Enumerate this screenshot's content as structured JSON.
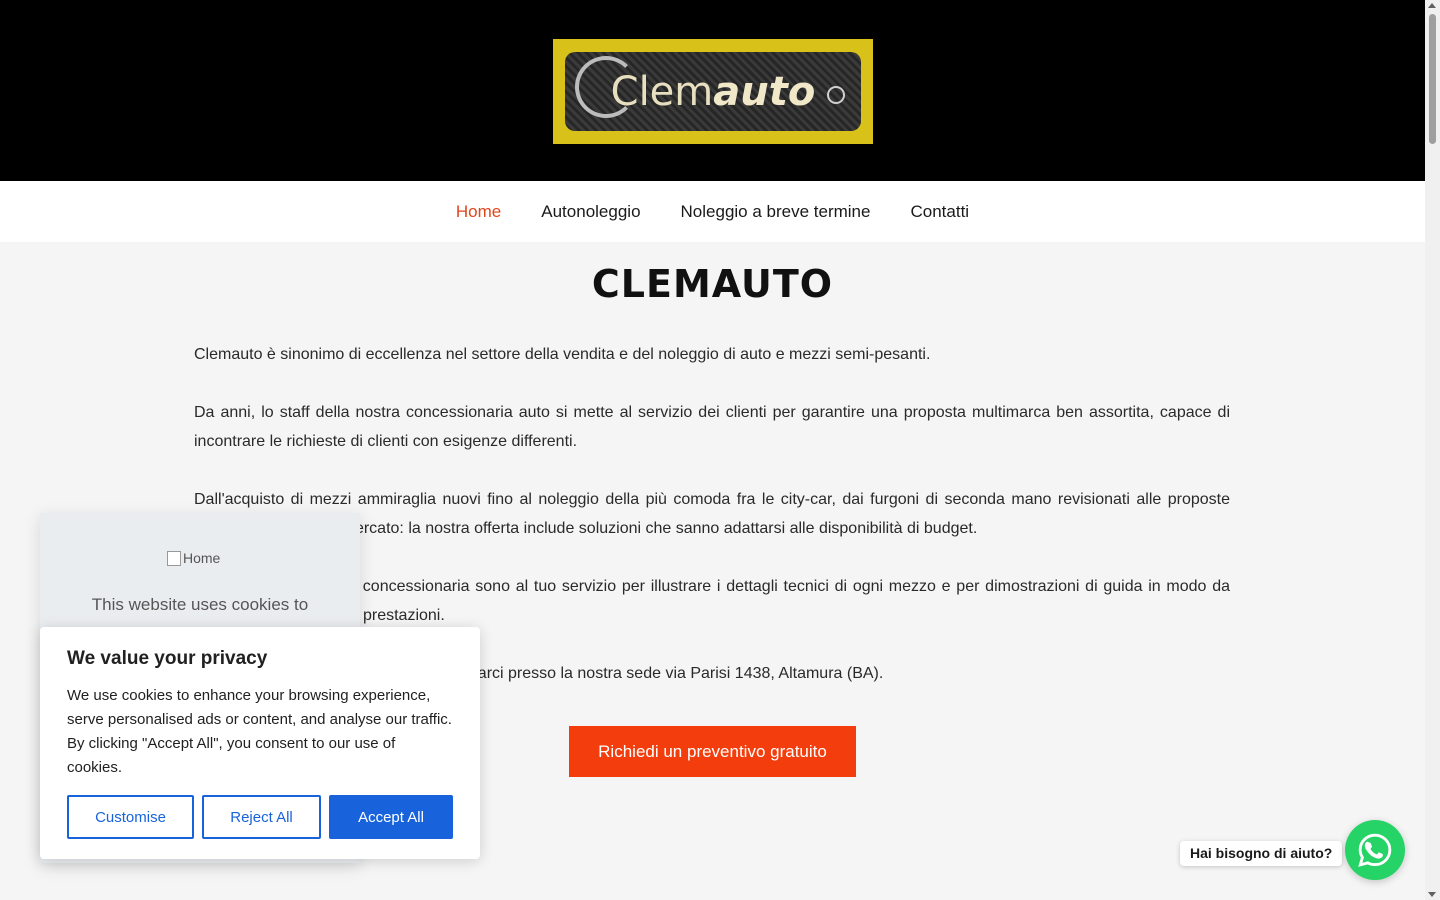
{
  "header": {
    "logo_text_plain": "Clem",
    "logo_text_bold": "auto"
  },
  "nav": {
    "items": [
      {
        "label": "Home",
        "active": true
      },
      {
        "label": "Autonoleggio",
        "active": false
      },
      {
        "label": "Noleggio a breve termine",
        "active": false
      },
      {
        "label": "Contatti",
        "active": false
      }
    ]
  },
  "main": {
    "title": "CLEMAUTO",
    "paragraphs": [
      "Clemauto è sinonimo di eccellenza nel settore della vendita e del noleggio di auto e mezzi semi-pesanti.",
      "Da anni, lo staff della nostra concessionaria auto si mette al servizio dei clienti per garantire una proposta multimarca ben assortita, capace di incontrare le richieste di clienti con esigenze differenti.",
      "Dall'acquisto di mezzi ammiraglia nuovi fino al noleggio della più comoda fra le city-car, dai furgoni di seconda mano revisionati alle proposte migliori proposte dal mercato: la nostra offerta include soluzioni che sanno adattarsi alle disponibilità di budget.",
      "Gli esperti della nostra concessionaria sono al tuo servizio per illustrare i dettagli tecnici di ogni mezzo e per dimostrazioni di guida in modo da verificare la bontà delle prestazioni.",
      "Se desideri valutare l'offerta, vieni a trovarci presso la nostra sede via Parisi 1438, Altamura (BA)."
    ],
    "cta_label": "Richiedi un preventivo gratuito"
  },
  "cookie_back": {
    "image_alt": "Home",
    "text": "This website uses cookies to"
  },
  "cookie_banner": {
    "title": "We value your privacy",
    "text": "We use cookies to enhance your browsing experience, serve personalised ads or content, and analyse our traffic. By clicking \"Accept All\", you consent to our use of cookies.",
    "customise_label": "Customise",
    "reject_label": "Reject All",
    "accept_label": "Accept All"
  },
  "whatsapp": {
    "help_label": "Hai bisogno di aiuto?",
    "icon": "whatsapp-icon"
  },
  "colors": {
    "accent": "#f43d0c",
    "nav_active": "#e2461c",
    "cookie_primary": "#1863dc",
    "whatsapp": "#25d366"
  }
}
